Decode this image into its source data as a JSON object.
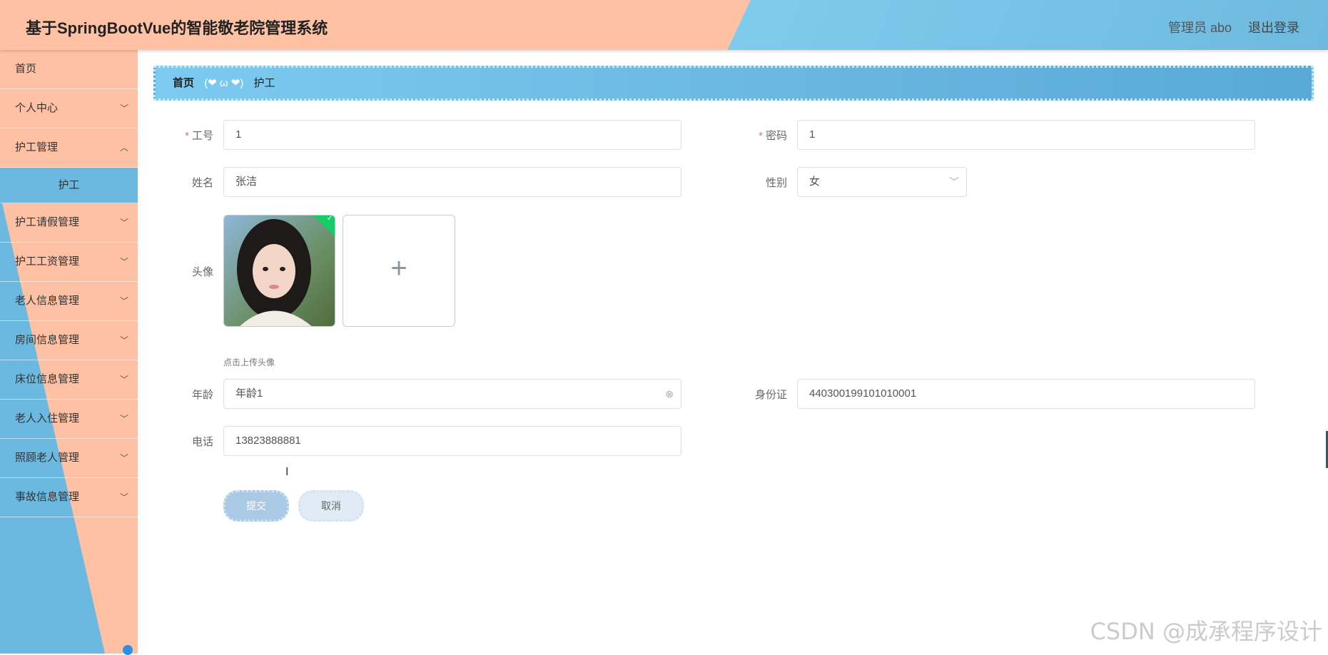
{
  "header": {
    "title": "基于SpringBootVue的智能敬老院管理系统",
    "user": "管理员 abo",
    "logout": "退出登录"
  },
  "sidebar": {
    "items": [
      {
        "label": "首页"
      },
      {
        "label": "个人中心"
      },
      {
        "label": "护工管理"
      },
      {
        "label": "护工"
      },
      {
        "label": "护工请假管理"
      },
      {
        "label": "护工工资管理"
      },
      {
        "label": "老人信息管理"
      },
      {
        "label": "房间信息管理"
      },
      {
        "label": "床位信息管理"
      },
      {
        "label": "老人入住管理"
      },
      {
        "label": "照顾老人管理"
      },
      {
        "label": "事故信息管理"
      }
    ]
  },
  "breadcrumb": {
    "home": "首页",
    "separator": "(❤ ω ❤)",
    "current": "护工"
  },
  "form": {
    "job_no": {
      "label": "工号",
      "value": "1"
    },
    "password": {
      "label": "密码",
      "value": "1"
    },
    "name": {
      "label": "姓名",
      "value": "张洁"
    },
    "gender": {
      "label": "性别",
      "value": "女"
    },
    "avatar": {
      "label": "头像",
      "tip": "点击上传头像"
    },
    "age": {
      "label": "年龄",
      "value": "年龄1"
    },
    "id_card": {
      "label": "身份证",
      "value": "440300199101010001"
    },
    "phone": {
      "label": "电话",
      "value": "13823888881"
    },
    "submit": "提交",
    "cancel": "取消"
  },
  "watermark": "CSDN @成承程序设计",
  "colors": {
    "peach": "#fec1a4",
    "blue": "#6bb9e0",
    "required": "#f56c6c"
  }
}
